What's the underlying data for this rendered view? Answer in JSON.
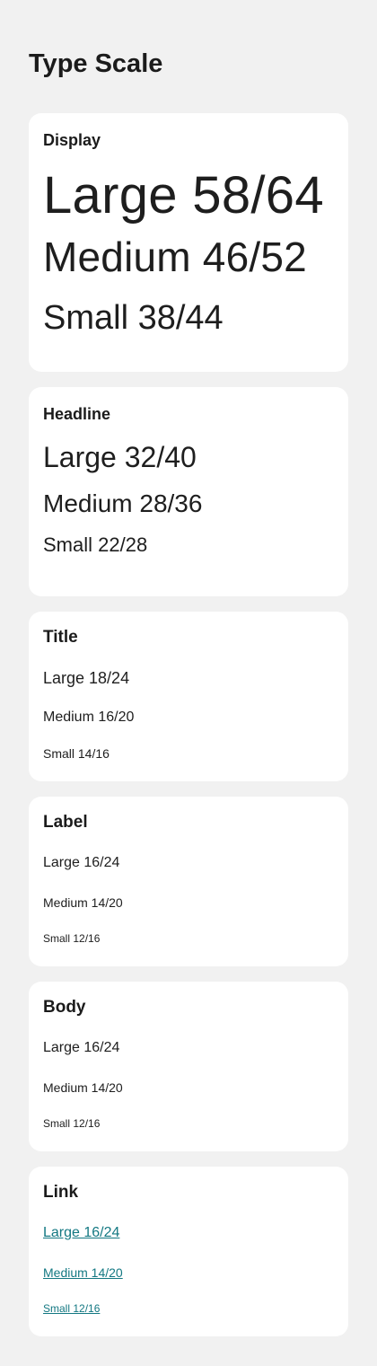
{
  "page": {
    "title": "Type Scale"
  },
  "colors": {
    "background": "#f1f1f1",
    "card": "#ffffff",
    "text": "#1c1c1c",
    "link": "#137882"
  },
  "sections": {
    "display": {
      "title": "Display",
      "large": "Large 58/64",
      "medium": "Medium 46/52",
      "small": "Small 38/44"
    },
    "headline": {
      "title": "Headline",
      "large": "Large 32/40",
      "medium": "Medium 28/36",
      "small": "Small 22/28"
    },
    "title": {
      "title": "Title",
      "large": "Large 18/24",
      "medium": "Medium 16/20",
      "small": "Small 14/16"
    },
    "label": {
      "title": "Label",
      "large": "Large 16/24",
      "medium": "Medium 14/20",
      "small": "Small 12/16"
    },
    "body": {
      "title": "Body",
      "large": "Large 16/24",
      "medium": "Medium 14/20",
      "small": "Small 12/16"
    },
    "link": {
      "title": "Link",
      "large": "Large 16/24",
      "medium": "Medium 14/20",
      "small": "Small 12/16"
    }
  }
}
